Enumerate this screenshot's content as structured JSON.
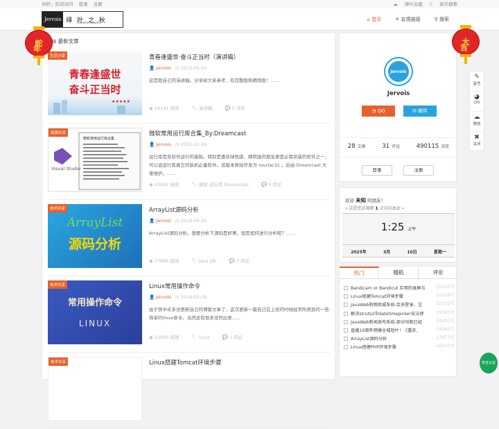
{
  "topbar": {
    "greeting": "你好，欢迎访问",
    "login": "登录",
    "register": "注册",
    "cloud": "绎叶云盘",
    "music": "音乐搜索"
  },
  "logo": {
    "en": "Jervois",
    "cn": "绎 叶 之 秋",
    "sub": "Autumn leaves"
  },
  "nav": [
    {
      "label": "首页",
      "icon": "home-icon"
    },
    {
      "label": "友情链接",
      "icon": "link-icon"
    },
    {
      "label": "搜索",
      "icon": "search-icon"
    }
  ],
  "main": {
    "title": "最新文章"
  },
  "posts": [
    {
      "badge": "生活分享",
      "thumb_text": [
        "青春逢盛世",
        "奋斗正当时"
      ],
      "title": "青春逢盛世·奋斗正当时（演讲稿）",
      "author": "Jervois",
      "date": "2023-05-03",
      "excerpt": "这是我自己的演讲稿。分享给大家参考，有完整版和精简版！......",
      "views": "19141 阅读",
      "tags": "演讲稿",
      "comments": "0 评论"
    },
    {
      "badge": "资源共享",
      "thumb_text": [
        "微软常用运行库合集",
        "Visual Studio"
      ],
      "title": "微软常用运行库合集_By:Dreamcast",
      "author": "Jervois",
      "date": "2021-12-26",
      "excerpt": "运行库是各软件运行的基础，特别是喜欢绿色版、精简版的朋友更是必需安装的软件之一，可以说运行库真正的装机必备软件。该版本原始开发为 rourtar31 ，后由 Dreamcast 大佬维护。......",
      "views": "20592 阅读",
      "tags": "微软 运行库 Dreamcast",
      "comments": "0 评论"
    },
    {
      "badge": "技术共享",
      "thumb_text": [
        "ArrayList",
        "源码分析"
      ],
      "title": "ArrayList源码分析",
      "author": "Jervois",
      "date": "2018-06-26",
      "excerpt": "ArrayList源码分析，想要分析下源码是好事，但是如何进行分析呢？......",
      "views": "27685 阅读",
      "tags": "Java jdk",
      "comments": "3 评论"
    },
    {
      "badge": "技术共享",
      "thumb_text": [
        "常用操作命令",
        "LINUX"
      ],
      "title": "Linux常用操作命令",
      "author": "Jervois",
      "date": "2018-03-09",
      "excerpt": "由于快半年多没更新自己的博客文章了，这次更新一篇自己在上班的时候经常所用到的一些简单的linux命令，当然还有很多没列出来......",
      "views": "21809 阅读",
      "tags": "linux",
      "comments": "3 评论"
    },
    {
      "badge": "技术共享",
      "thumb_text": [
        "",
        ""
      ],
      "title": "Linux搭建Tomcat环境步骤",
      "author": "",
      "date": "",
      "excerpt": "",
      "views": "",
      "tags": "",
      "comments": ""
    }
  ],
  "profile": {
    "avatar_text": "Jervois",
    "name": "Jervois",
    "qq": "QQ",
    "mail": "邮件",
    "counts": [
      {
        "num": "28",
        "label": "文章"
      },
      {
        "num": "31",
        "label": "评论"
      },
      {
        "num": "490115",
        "label": "浏览"
      }
    ],
    "login": "登录",
    "register": "注册"
  },
  "clock": {
    "welcome_pre": "欢迎",
    "welcome_name": "未知",
    "welcome_post": "的朋友！",
    "hint_pre": "» 这是您近期第",
    "hint_num": "1",
    "hint_post": "次访问本站 »",
    "time": "1:25",
    "ampm": "上午",
    "year": "2025年",
    "month": "3月",
    "day": "10日",
    "weekday": "星期一"
  },
  "tabs": [
    {
      "label": "热门"
    },
    {
      "label": "随机"
    },
    {
      "label": "评论"
    }
  ],
  "hot": [
    {
      "title": "Bandicam or Bandicut 实用的录屏与",
      "n": "35123℃"
    },
    {
      "title": "Linux搭建Tomcat环境步骤",
      "n": "33218℃"
    },
    {
      "title": "JavaWeb购物商城系统-会员登录、注",
      "n": "32331℃"
    },
    {
      "title": "解决struts2中datetimepicker无法使",
      "n": "29281℃"
    },
    {
      "title": "JavaWeb新闻发布系统-部分功能已经",
      "n": "29205℃"
    },
    {
      "title": "直播19周年燃爆全城短片！《重庆,",
      "n": "28265℃"
    },
    {
      "title": "ArrayList源码分析",
      "n": "27877℃"
    },
    {
      "title": "Linux搭建PHP环境步骤",
      "n": "26252℃"
    }
  ],
  "lanterns": {
    "left": [
      "蛇",
      "年"
    ],
    "right": [
      "大",
      "吉"
    ]
  },
  "float": [
    {
      "label": "留言",
      "icon": "message-icon"
    },
    {
      "label": "QQ",
      "icon": "qq-icon"
    },
    {
      "label": "微信",
      "icon": "wechat-icon"
    },
    {
      "label": "关闭",
      "icon": "close-icon"
    }
  ],
  "security": "安全认证"
}
